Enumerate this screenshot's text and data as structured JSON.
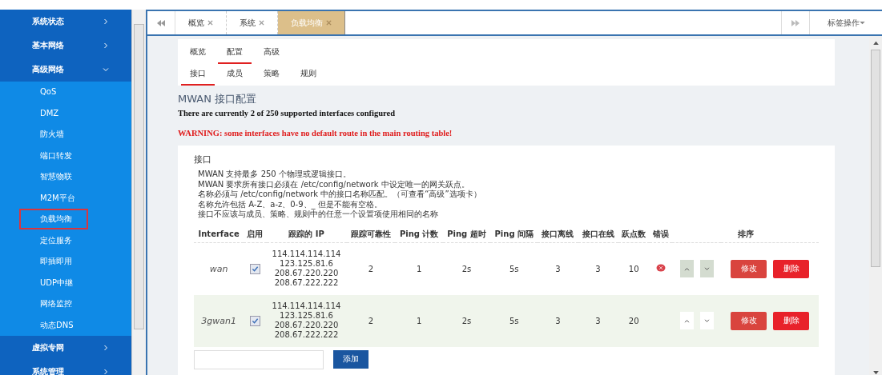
{
  "sidebar": {
    "menu": [
      {
        "label": "系统状态",
        "expanded": false
      },
      {
        "label": "基本网络",
        "expanded": false
      },
      {
        "label": "高级网络",
        "expanded": true,
        "children": [
          {
            "label": "QoS",
            "selected": false
          },
          {
            "label": "DMZ",
            "selected": false
          },
          {
            "label": "防火墙",
            "selected": false
          },
          {
            "label": "端口转发",
            "selected": false
          },
          {
            "label": "智慧物联",
            "selected": false
          },
          {
            "label": "M2M平台",
            "selected": false
          },
          {
            "label": "负载均衡",
            "selected": true
          },
          {
            "label": "定位服务",
            "selected": false
          },
          {
            "label": "即插即用",
            "selected": false
          },
          {
            "label": "UDP中继",
            "selected": false
          },
          {
            "label": "网络监控",
            "selected": false
          },
          {
            "label": "动态DNS",
            "selected": false
          }
        ]
      },
      {
        "label": "虚拟专网",
        "expanded": false
      },
      {
        "label": "系统管理",
        "expanded": false
      }
    ]
  },
  "tabs": [
    {
      "label": "概览",
      "selected": false
    },
    {
      "label": "系统",
      "selected": false
    },
    {
      "label": "负载均衡",
      "selected": true
    }
  ],
  "tab_actions": "标签操作",
  "subtabs": [
    {
      "label": "概览",
      "selected": false
    },
    {
      "label": "配置",
      "selected": true
    },
    {
      "label": "高级",
      "selected": false
    }
  ],
  "section_tabs": [
    {
      "label": "接口",
      "selected": true
    },
    {
      "label": "成员",
      "selected": false
    },
    {
      "label": "策略",
      "selected": false
    },
    {
      "label": "规则",
      "selected": false
    }
  ],
  "heading": "MWAN 接口配置",
  "status": "There are currently 2 of 250 supported interfaces configured",
  "warning": "WARNING: some interfaces have no default route in the main routing table!",
  "panel": {
    "title": "接口",
    "notes": [
      "MWAN 支持最多 250 个物理或逻辑接口。",
      "MWAN 要求所有接口必须在 /etc/config/network 中设定唯一的网关跃点。",
      "名称必须与 /etc/config/network 中的接口名称匹配。（可查看“高级”选项卡）",
      "名称允许包括 A-Z、a-z、0-9、_ 但是不能有空格。",
      "接口不应该与成员、策略、规则中的任意一个设置项使用相同的名称"
    ]
  },
  "table": {
    "columns": [
      "Interface",
      "启用",
      "跟踪的 IP",
      "跟踪可靠性",
      "Ping 计数",
      "Ping 超时",
      "Ping 间隔",
      "接口离线",
      "接口在线",
      "跃点数",
      "错误",
      "排序"
    ],
    "rows": [
      {
        "interface": "wan",
        "enabled": true,
        "ips": [
          "114.114.114.114",
          "123.125.81.6",
          "208.67.220.220",
          "208.67.222.222"
        ],
        "reliability": "2",
        "count": "1",
        "timeout": "2s",
        "interval": "5s",
        "down": "3",
        "up": "3",
        "metric": "10",
        "error": true,
        "edit": "修改",
        "delete": "删除"
      },
      {
        "interface": "3gwan1",
        "enabled": true,
        "ips": [
          "114.114.114.114",
          "123.125.81.6",
          "208.67.220.220",
          "208.67.222.222"
        ],
        "reliability": "2",
        "count": "1",
        "timeout": "2s",
        "interval": "5s",
        "down": "3",
        "up": "3",
        "metric": "20",
        "error": false,
        "edit": "修改",
        "delete": "删除"
      }
    ]
  },
  "add_button": "添加"
}
